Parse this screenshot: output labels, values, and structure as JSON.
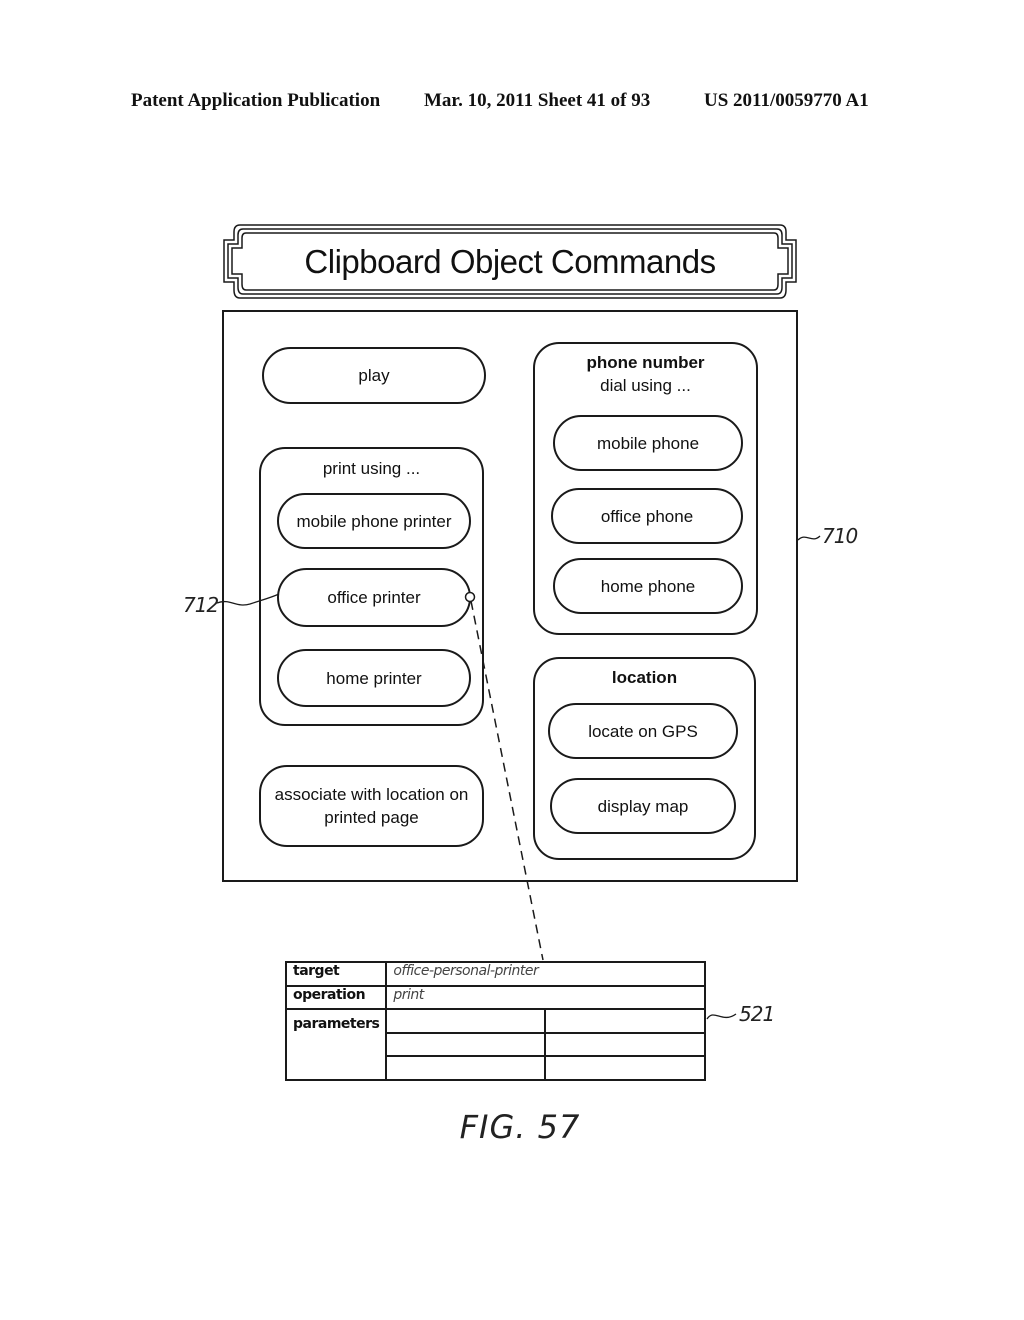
{
  "header": {
    "publication": "Patent Application Publication",
    "date_sheet": "Mar. 10, 2011  Sheet 41 of 93",
    "patent_number": "US 2011/0059770 A1"
  },
  "panel": {
    "title": "Clipboard Object Commands",
    "reference": "710",
    "left_column": {
      "play": "play",
      "print_group": {
        "title": "print using ...",
        "items": [
          "mobile phone printer",
          "office printer",
          "home printer"
        ],
        "selected_reference": "712"
      },
      "associate": "associate with location on printed page"
    },
    "right_column": {
      "phone_group": {
        "title": "phone number",
        "subtitle": "dial using ...",
        "items": [
          "mobile phone",
          "office phone",
          "home phone"
        ]
      },
      "location_group": {
        "title": "location",
        "items": [
          "locate on GPS",
          "display map"
        ]
      }
    }
  },
  "record": {
    "reference": "521",
    "rows": [
      {
        "key": "target",
        "value": "office-personal-printer"
      },
      {
        "key": "operation",
        "value": "print"
      },
      {
        "key": "parameters",
        "value": ""
      }
    ],
    "parameter_cells": [
      [
        "",
        ""
      ],
      [
        "",
        ""
      ],
      [
        "",
        ""
      ]
    ]
  },
  "figure_label": "FIG. 57"
}
